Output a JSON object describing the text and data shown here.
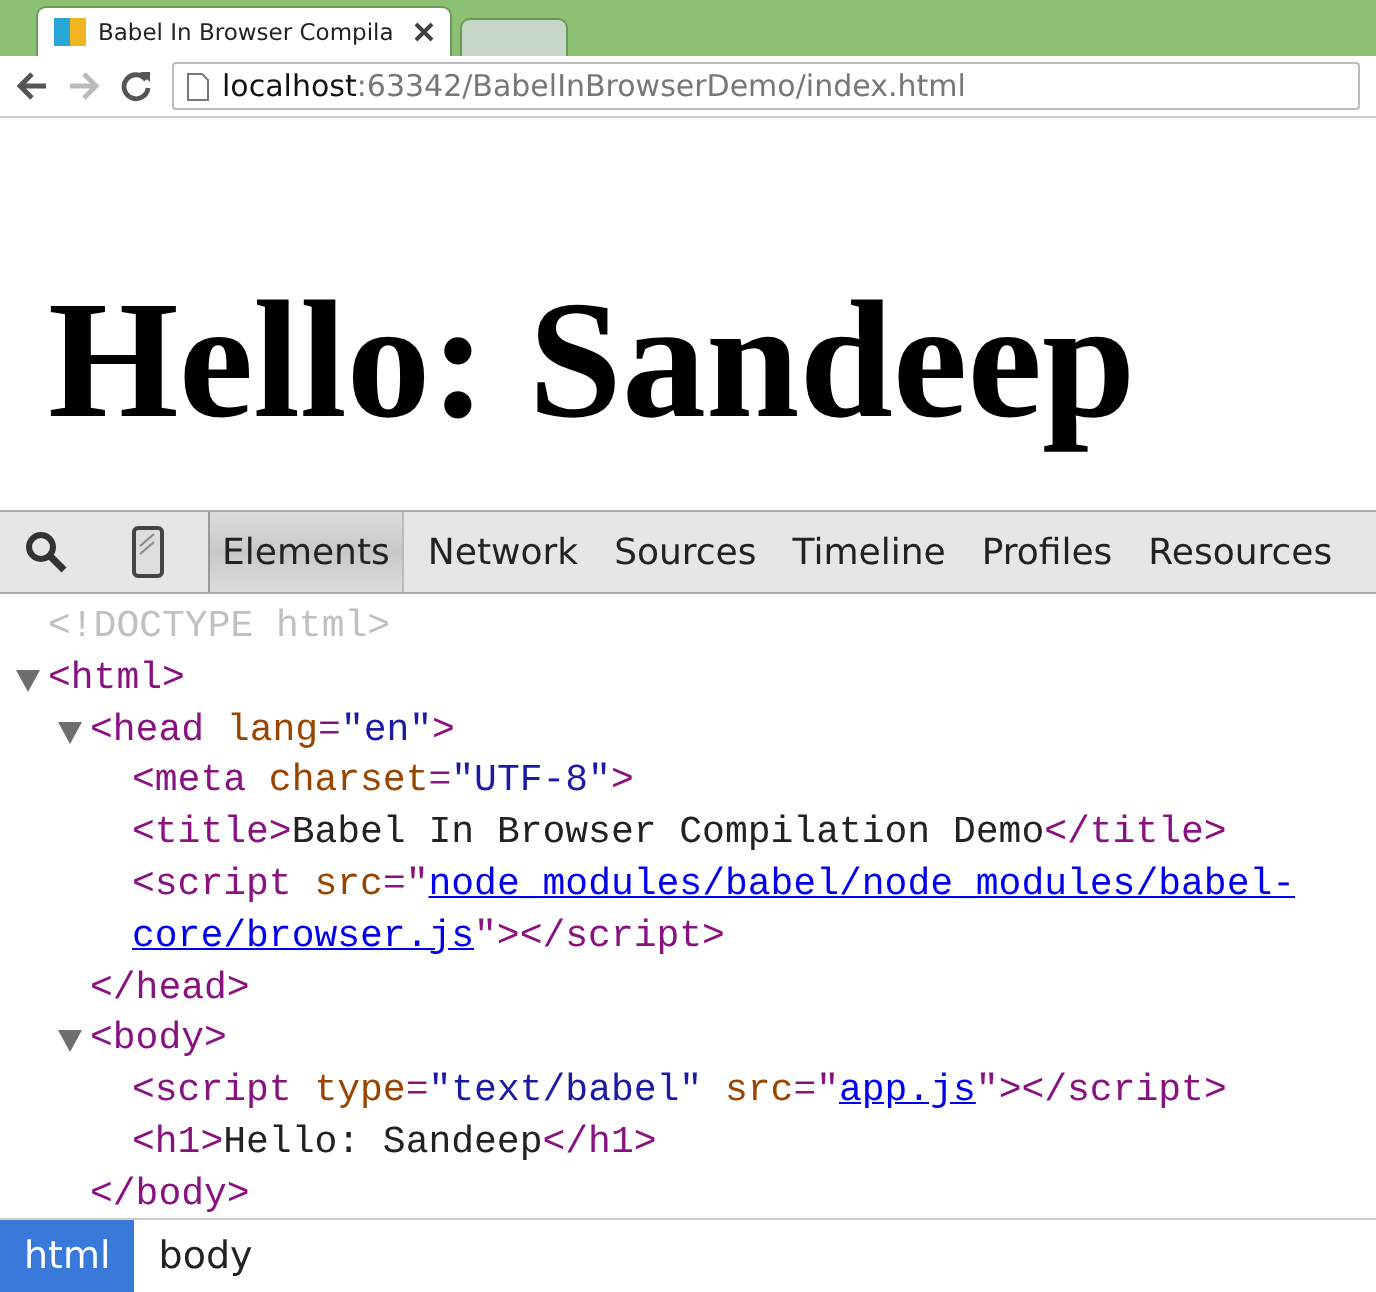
{
  "browser": {
    "tabs": [
      {
        "title": "Babel In Browser Compila",
        "selected": true
      },
      {
        "selected": false
      }
    ],
    "address": {
      "host": "localhost",
      "rest": ":63342/BabelInBrowserDemo/index.html"
    }
  },
  "page": {
    "heading": "Hello: Sandeep"
  },
  "devtools": {
    "panels": [
      {
        "label": "Elements",
        "selected": true
      },
      {
        "label": "Network",
        "selected": false
      },
      {
        "label": "Sources",
        "selected": false
      },
      {
        "label": "Timeline",
        "selected": false
      },
      {
        "label": "Profiles",
        "selected": false
      },
      {
        "label": "Resources",
        "selected": false
      }
    ],
    "tree": [
      {
        "tokens": [
          {
            "kind": "doctype",
            "text": "<!DOCTYPE html>"
          }
        ]
      },
      {
        "expanded": true,
        "tokens": [
          {
            "kind": "tag",
            "text": "<html>"
          }
        ],
        "children": [
          {
            "expanded": true,
            "tokens": [
              {
                "kind": "tag",
                "text": "<head"
              },
              {
                "kind": "attr",
                "text": " lang"
              },
              {
                "kind": "tag",
                "text": "="
              },
              {
                "kind": "value",
                "text": "\"en\""
              },
              {
                "kind": "tag",
                "text": ">"
              }
            ],
            "closing": [
              {
                "kind": "tag",
                "text": "</head>"
              }
            ],
            "children": [
              {
                "tokens": [
                  {
                    "kind": "tag",
                    "text": "<meta"
                  },
                  {
                    "kind": "attr",
                    "text": " charset"
                  },
                  {
                    "kind": "tag",
                    "text": "="
                  },
                  {
                    "kind": "value",
                    "text": "\"UTF-8\""
                  },
                  {
                    "kind": "tag",
                    "text": ">"
                  }
                ]
              },
              {
                "tokens": [
                  {
                    "kind": "tag",
                    "text": "<title>"
                  },
                  {
                    "kind": "text",
                    "text": "Babel In Browser Compilation Demo"
                  },
                  {
                    "kind": "tag",
                    "text": "</title>"
                  }
                ]
              },
              {
                "tokens": [
                  {
                    "kind": "tag",
                    "text": "<script"
                  },
                  {
                    "kind": "attr",
                    "text": " src"
                  },
                  {
                    "kind": "tag",
                    "text": "=\""
                  },
                  {
                    "kind": "link",
                    "text": "node_modules/babel/node_modules/babel-"
                  },
                  {
                    "kind": "link",
                    "text": "core/browser.js"
                  },
                  {
                    "kind": "tag",
                    "text": "\"></script>"
                  }
                ]
              }
            ]
          },
          {
            "expanded": true,
            "tokens": [
              {
                "kind": "tag",
                "text": "<body>"
              }
            ],
            "closing": [
              {
                "kind": "tag",
                "text": "</body>"
              }
            ],
            "children": [
              {
                "tokens": [
                  {
                    "kind": "tag",
                    "text": "<script"
                  },
                  {
                    "kind": "attr",
                    "text": " type"
                  },
                  {
                    "kind": "tag",
                    "text": "="
                  },
                  {
                    "kind": "value",
                    "text": "\"text/babel\""
                  },
                  {
                    "kind": "attr",
                    "text": " src"
                  },
                  {
                    "kind": "tag",
                    "text": "=\""
                  },
                  {
                    "kind": "link",
                    "text": "app.js"
                  },
                  {
                    "kind": "tag",
                    "text": "\"></script>"
                  }
                ]
              },
              {
                "tokens": [
                  {
                    "kind": "tag",
                    "text": "<h1>"
                  },
                  {
                    "kind": "text",
                    "text": "Hello: Sandeep"
                  },
                  {
                    "kind": "tag",
                    "text": "</h1>"
                  }
                ]
              }
            ]
          }
        ]
      }
    ],
    "breadcrumbs": [
      {
        "label": "html",
        "selected": true
      },
      {
        "label": "body",
        "selected": false
      }
    ]
  }
}
